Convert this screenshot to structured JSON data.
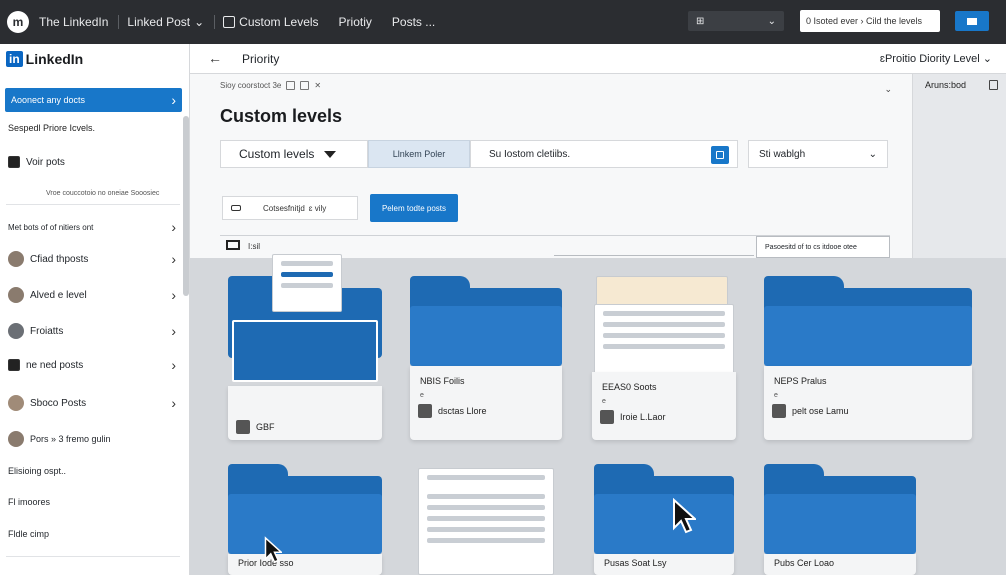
{
  "topbar": {
    "logo": "m",
    "app_name": "The LinkedIn",
    "menu_linked_post": "Linked Post",
    "menu_custom_levels": "Custom Levels",
    "menu_priority": "Priotiy",
    "menu_posts": "Posts ...",
    "search_text": "0 Isoted ever › Cild the levels"
  },
  "sidebar": {
    "brand_prefix": "in",
    "brand_name": "LinkedIn",
    "primary_button": "Aoonect any docts",
    "subheading": "Sespedl Priore Icvels.",
    "vote_posts": "Voir pots",
    "meta_line": "Vroe couccotoio no oneiae      Sooosiec",
    "items": [
      {
        "label": "Met bots of of nitiers ont"
      },
      {
        "label": "Cfiad thposts"
      },
      {
        "label": "Alved e level"
      },
      {
        "label": "Froiatts"
      },
      {
        "label": "ne ned posts"
      },
      {
        "label": "Sboco Posts"
      },
      {
        "label": "Pors » 3 fremo gulin"
      },
      {
        "label": "Elisioing ospt.."
      },
      {
        "label": "Fl imoores"
      },
      {
        "label": "Fldle cimp"
      }
    ]
  },
  "header": {
    "back": "←",
    "title": "Priority",
    "right": "ɛProitio Diority Level ⌄"
  },
  "panel": {
    "crumb": "Sioy coorstoct 3e",
    "heading": "Custom levels",
    "select_a": "Custom levels",
    "tab_b": "Llnkem Poler",
    "input_c": "Su Iostom cletiibs.",
    "select_d": "Sti wablgh",
    "chip": "Cotsesfnitjd",
    "chip_suffix": "ɛ vily",
    "blue_button": "Pelem todte posts",
    "toolbar_label": "I:sil",
    "toolbar_right": "Pasoesitd of to cs itdooe otee",
    "right_label": "Aruns:bod",
    "dropdown_caret": "⌄"
  },
  "folders": [
    {
      "t1": "",
      "t2": "",
      "t3": "GBF"
    },
    {
      "t1": "NBIS Foilis",
      "t2": "e",
      "t3": "dsctas Llore"
    },
    {
      "t1": "EEAS0 Soots",
      "t2": "e",
      "t3": "Iroie L.Laor"
    },
    {
      "t1": "NEPS Pralus",
      "t2": "e",
      "t3": "pelt ose Lamu"
    },
    {
      "t1": "Prior Iode sso",
      "t2": "",
      "t3": ""
    },
    {
      "t1": "",
      "t2": "",
      "t3": ""
    },
    {
      "t1": "Pusas Soat Lsy",
      "t2": "",
      "t3": ""
    },
    {
      "t1": "Pubs Cer Loao",
      "t2": "",
      "t3": ""
    }
  ],
  "colors": {
    "topbar": "#2b2d31",
    "accent": "#1877c9",
    "folder": "#1e6ab3"
  }
}
